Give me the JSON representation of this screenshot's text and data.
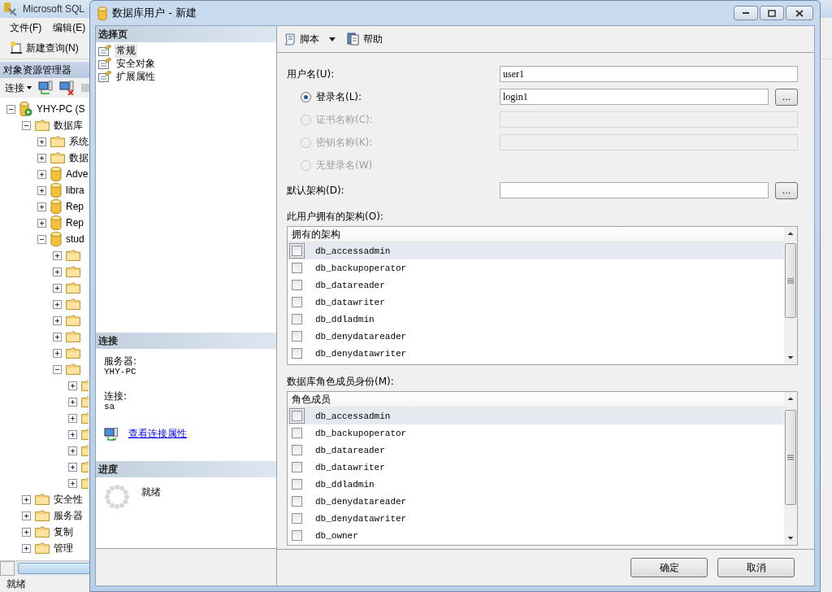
{
  "background_window": {
    "title": "Microsoft SQL",
    "menu": [
      "文件(F)",
      "编辑(E)"
    ],
    "toolbar": {
      "new_query": "新建查询(N)"
    },
    "object_explorer": {
      "title": "对象资源管理器",
      "connect": "连接",
      "tree": [
        {
          "kind": "server",
          "label": "YHY-PC (S",
          "expanded": true,
          "children": [
            {
              "kind": "folder",
              "label": "数据库",
              "expanded": true,
              "children": [
                {
                  "kind": "folder",
                  "label": "系统",
                  "expanded": false
                },
                {
                  "kind": "folder",
                  "label": "数据",
                  "expanded": false
                },
                {
                  "kind": "database",
                  "label": "Adve",
                  "expanded": false
                },
                {
                  "kind": "database",
                  "label": "libra",
                  "expanded": false
                },
                {
                  "kind": "database",
                  "label": "Rep",
                  "expanded": false
                },
                {
                  "kind": "database",
                  "label": "Rep",
                  "expanded": false
                },
                {
                  "kind": "database",
                  "label": "stud",
                  "expanded": true,
                  "children": [
                    {
                      "kind": "folder",
                      "expanded": false
                    },
                    {
                      "kind": "folder",
                      "expanded": false
                    },
                    {
                      "kind": "folder",
                      "expanded": false
                    },
                    {
                      "kind": "folder",
                      "expanded": false
                    },
                    {
                      "kind": "folder",
                      "expanded": false
                    },
                    {
                      "kind": "folder",
                      "expanded": false
                    },
                    {
                      "kind": "folder",
                      "expanded": false
                    },
                    {
                      "kind": "folder",
                      "expanded": true,
                      "children": [
                        {
                          "kind": "folder",
                          "expanded": false
                        },
                        {
                          "kind": "folder",
                          "expanded": false
                        },
                        {
                          "kind": "folder",
                          "expanded": false
                        },
                        {
                          "kind": "folder",
                          "expanded": false
                        },
                        {
                          "kind": "folder",
                          "expanded": false
                        },
                        {
                          "kind": "folder",
                          "expanded": false
                        },
                        {
                          "kind": "folder",
                          "expanded": false
                        }
                      ]
                    }
                  ]
                }
              ]
            },
            {
              "kind": "folder",
              "label": "安全性",
              "expanded": false
            },
            {
              "kind": "folder",
              "label": "服务器",
              "expanded": false
            },
            {
              "kind": "folder",
              "label": "复制",
              "expanded": false
            },
            {
              "kind": "folder",
              "label": "管理",
              "expanded": false
            }
          ]
        }
      ]
    },
    "status_bar": "就绪"
  },
  "dialog": {
    "title": "数据库用户 - 新建",
    "select_page": {
      "title": "选择页",
      "items": [
        {
          "label": "常规",
          "selected": true
        },
        {
          "label": "安全对象",
          "selected": false
        },
        {
          "label": "扩展属性",
          "selected": false
        }
      ]
    },
    "connection": {
      "title": "连接",
      "server_label": "服务器:",
      "server": "YHY-PC",
      "connection_label": "连接:",
      "connection": "sa",
      "link": "查看连接属性"
    },
    "progress": {
      "title": "进度",
      "status": "就绪"
    },
    "toolbar": {
      "script": "脚本",
      "help": "帮助"
    },
    "form": {
      "user_name": {
        "label": "用户名(U):",
        "value": "user1"
      },
      "login_options": [
        {
          "label": "登录名(L):",
          "selected": true,
          "disabled": false,
          "has_field": true,
          "value": "login1",
          "browse": "..."
        },
        {
          "label": "证书名称(C):",
          "selected": false,
          "disabled": true,
          "has_field": true
        },
        {
          "label": "密钥名称(K):",
          "selected": false,
          "disabled": true,
          "has_field": true
        },
        {
          "label": "无登录名(W)",
          "selected": false,
          "disabled": true,
          "has_field": false
        }
      ],
      "default_schema": {
        "label": "默认架构(D):",
        "browse": "..."
      },
      "owned_schemas": {
        "label": "此用户拥有的架构(O):",
        "column": "拥有的架构",
        "rows": [
          {
            "name": "db_accessadmin",
            "checked": false,
            "selected": true
          },
          {
            "name": "db_backupoperator",
            "checked": false,
            "selected": false
          },
          {
            "name": "db_datareader",
            "checked": false,
            "selected": false
          },
          {
            "name": "db_datawriter",
            "checked": false,
            "selected": false
          },
          {
            "name": "db_ddladmin",
            "checked": false,
            "selected": false
          },
          {
            "name": "db_denydatareader",
            "checked": false,
            "selected": false
          },
          {
            "name": "db_denydatawriter",
            "checked": false,
            "selected": false
          }
        ]
      },
      "role_membership": {
        "label": "数据库角色成员身份(M):",
        "column": "角色成员",
        "rows": [
          {
            "name": "db_accessadmin",
            "checked": false,
            "selected": true
          },
          {
            "name": "db_backupoperator",
            "checked": false,
            "selected": false
          },
          {
            "name": "db_datareader",
            "checked": false,
            "selected": false
          },
          {
            "name": "db_datawriter",
            "checked": false,
            "selected": false
          },
          {
            "name": "db_ddladmin",
            "checked": false,
            "selected": false
          },
          {
            "name": "db_denydatareader",
            "checked": false,
            "selected": false
          },
          {
            "name": "db_denydatawriter",
            "checked": false,
            "selected": false
          },
          {
            "name": "db_owner",
            "checked": false,
            "selected": false
          }
        ]
      }
    },
    "buttons": [
      "确定",
      "取消"
    ]
  }
}
